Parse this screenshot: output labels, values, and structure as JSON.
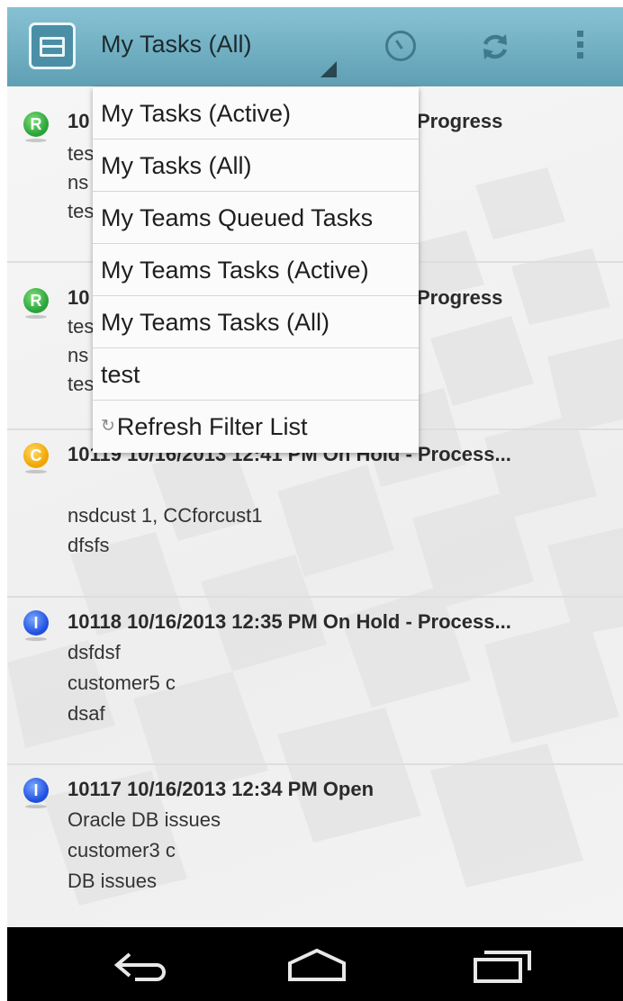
{
  "action_bar": {
    "title": "My Tasks (All)",
    "icons": [
      "app-icon",
      "gauge-icon",
      "refresh-icon",
      "overflow-menu-icon"
    ]
  },
  "dropdown": {
    "items": [
      {
        "label": "My Tasks (Active)"
      },
      {
        "label": "My Tasks (All)"
      },
      {
        "label": "My Teams Queued Tasks"
      },
      {
        "label": "My Teams Tasks (Active)"
      },
      {
        "label": "My Teams Tasks (All)"
      },
      {
        "label": "test"
      },
      {
        "label": "Refresh Filter List",
        "icon": "↻"
      }
    ]
  },
  "tasks": [
    {
      "badge": "R",
      "badge_color": "#2aa33a",
      "header_left": "10",
      "header_right": "Progress",
      "lines": [
        "tes",
        "ns",
        "tes"
      ]
    },
    {
      "badge": "R",
      "badge_color": "#2aa33a",
      "header_left": "10",
      "header_right": "Progress",
      "lines": [
        "tes",
        "ns",
        "tes"
      ]
    },
    {
      "badge": "C",
      "badge_color": "#f0a500",
      "header": "10119   10/16/2013 12:41 PM   On Hold - Process...",
      "lines": [
        "nsdcust 1, CCforcust1",
        "dfsfs"
      ]
    },
    {
      "badge": "I",
      "badge_color": "#1f4fe0",
      "header": "10118   10/16/2013 12:35 PM   On Hold - Process...",
      "lines": [
        "dsfdsf",
        "customer5 c",
        "dsaf"
      ]
    },
    {
      "badge": "I",
      "badge_color": "#1f4fe0",
      "header": "10117   10/16/2013 12:34 PM   Open",
      "lines": [
        "Oracle DB issues",
        "customer3 c",
        "DB issues"
      ]
    }
  ],
  "nav_bar": {
    "icons": [
      "back-icon",
      "home-icon",
      "recent-apps-icon"
    ]
  }
}
